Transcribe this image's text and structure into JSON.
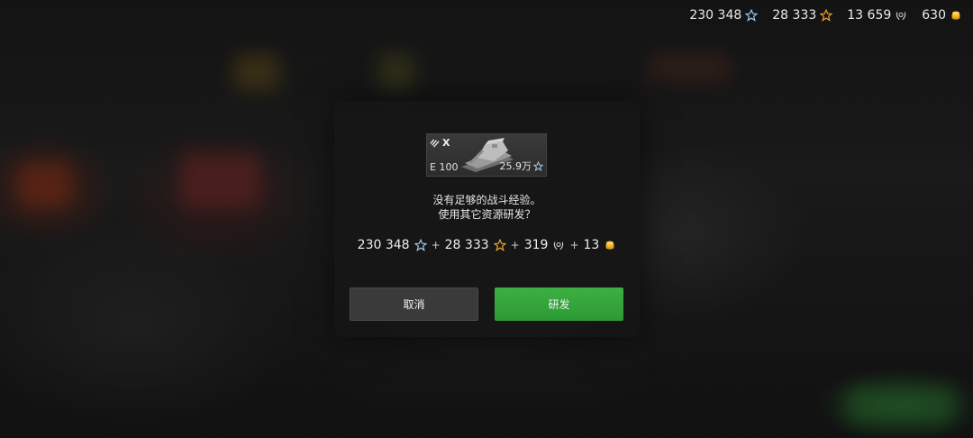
{
  "topbar": {
    "free_xp": "230 348",
    "vehicle_xp": "28 333",
    "credits_icon_value": "13 659",
    "gold": "630"
  },
  "dialog": {
    "vehicle": {
      "tier": "X",
      "name": "E 100",
      "xp_cost": "25.9万"
    },
    "message_line1": "没有足够的战斗经验。",
    "message_line2": "使用其它资源研发？",
    "cost": {
      "free_xp": "230 348",
      "plus1": "+",
      "vehicle_xp": "28 333",
      "plus2": "+",
      "wreath": "319",
      "plus3": "+",
      "gold": "13"
    },
    "cancel_label": "取消",
    "research_label": "研发"
  },
  "colors": {
    "accent_green": "#3cb043",
    "free_xp_star": "#9fc9e8",
    "vehicle_xp_star": "#f0a628",
    "gold": "#f3b82a"
  }
}
